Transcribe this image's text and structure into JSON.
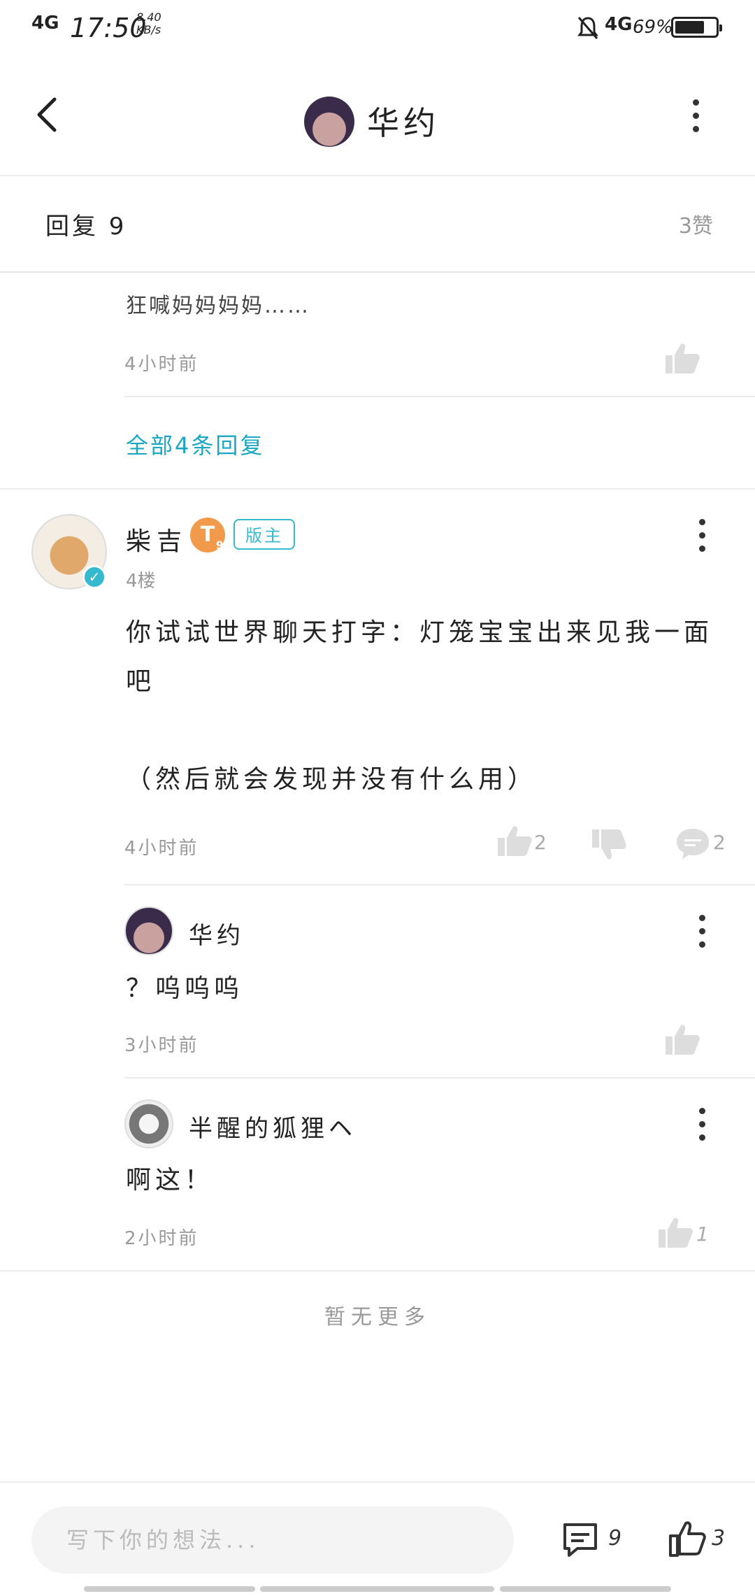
{
  "status_bar": {
    "network_left": "4G",
    "time": "17:50",
    "speed_value": "8.40",
    "speed_unit": "KB/s",
    "network_right": "4G",
    "battery": "69%",
    "battery_level": 0.69
  },
  "header": {
    "title": "华约"
  },
  "reply_bar": {
    "reply_count_label": "回复 9",
    "like_label": "3赞"
  },
  "prev_floor_tail": {
    "reply_text": "狂喊妈妈妈妈……",
    "time": "4小时前",
    "all_replies_link": "全部4条回复"
  },
  "post": {
    "username": "柴吉",
    "level_badge": "T",
    "level_num": "9",
    "mod_badge": "版主",
    "floor": "4楼",
    "body_line1": "你试试世界聊天打字：灯笼宝宝出来见我一面吧",
    "body_line2": "（然后就会发现并没有什么用）",
    "time": "4小时前",
    "like_count": "2",
    "comment_count": "2"
  },
  "nested_replies": [
    {
      "username": "华约",
      "text": "？呜呜呜",
      "time": "3小时前",
      "like_count": ""
    },
    {
      "username": "半醒的狐狸ヘ",
      "text": "啊这！",
      "time": "2小时前",
      "like_count": "1"
    }
  ],
  "no_more": "暂无更多",
  "bottom_bar": {
    "input_placeholder": "写下你的想法...",
    "comment_count": "9",
    "like_count": "3"
  },
  "colors": {
    "accent": "#1ba7c2",
    "mod_badge": "#35b9cf",
    "level_badge": "#f29a4b"
  },
  "icons": [
    "back-arrow-icon",
    "more-vertical-icon",
    "thumbs-up-icon",
    "thumbs-down-icon",
    "comment-icon",
    "verified-icon"
  ]
}
